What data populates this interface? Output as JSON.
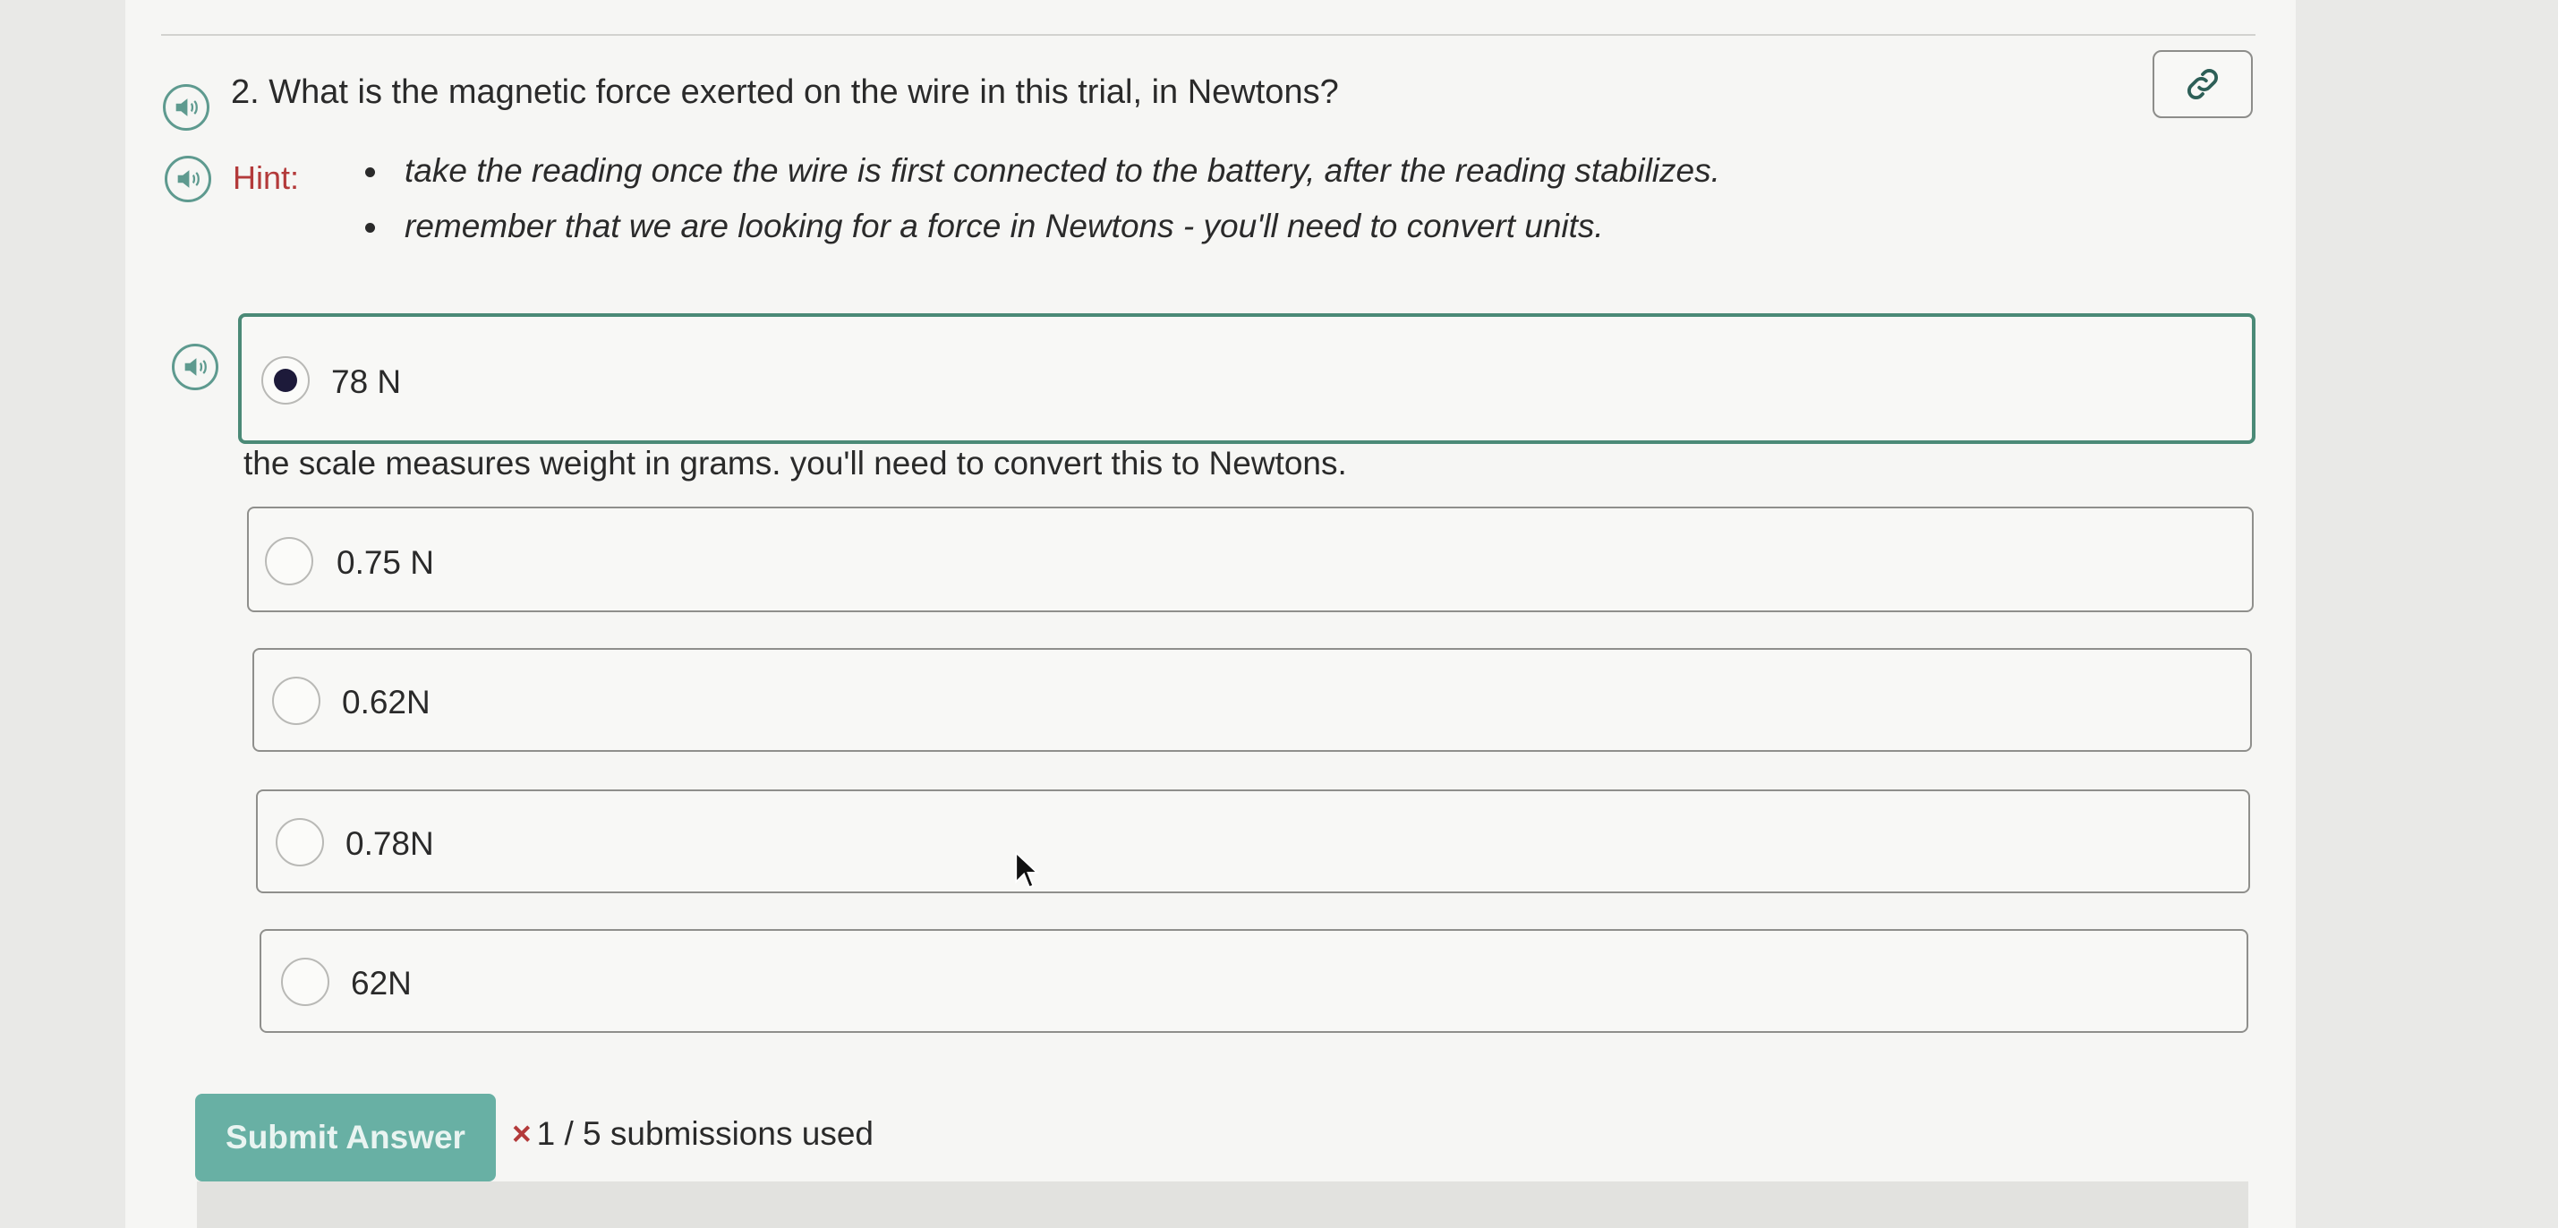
{
  "question": {
    "number": "2.",
    "text": "What is the magnetic force exerted on the wire in this trial, in Newtons?"
  },
  "hint": {
    "label": "Hint:",
    "items": [
      "take the reading once the wire is first connected to the battery, after the reading stabilizes.",
      "remember that we are looking for a force in Newtons - you'll need to convert units."
    ]
  },
  "options": [
    {
      "label": "78 N",
      "selected": true
    },
    {
      "label": "0.75 N",
      "selected": false
    },
    {
      "label": "0.62N",
      "selected": false
    },
    {
      "label": "0.78N",
      "selected": false
    },
    {
      "label": "62N",
      "selected": false
    }
  ],
  "feedback": "the scale measures weight in grams. you'll need to convert this to Newtons.",
  "submit": {
    "label": "Submit Answer"
  },
  "status": {
    "icon": "×",
    "text": "1 / 5 submissions used"
  },
  "icons": {
    "speaker": "speaker-icon",
    "link": "link-icon",
    "cursor": "cursor-icon"
  },
  "colors": {
    "accent": "#68b0a4",
    "selected_border": "#4b8a77",
    "hint": "#b33a3a",
    "radio_fill": "#1d1a3a"
  }
}
